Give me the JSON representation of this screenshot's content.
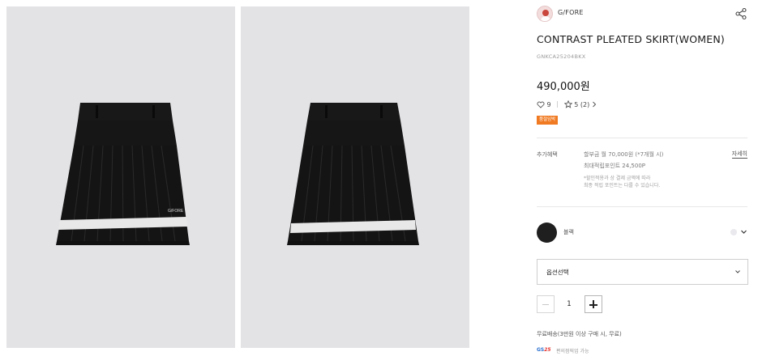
{
  "gallery": {
    "images": [
      {
        "alt": "",
        "logo_text": "G/FORE"
      },
      {
        "alt": ""
      }
    ]
  },
  "product": {
    "brand": "G/FORE",
    "title": "CONTRAST PLEATED SKIRT(WOMEN)",
    "code": "GNKCA25204BKX",
    "price": "490,000원",
    "likes": "9",
    "rating": "5",
    "reviews": "(2)",
    "badge": "품절임박"
  },
  "benefits": {
    "label": "추가혜택",
    "line1": "할부금 월 70,000원 (*7개월 시)",
    "line2": "최대적립포인트 24,500P",
    "note1": "*할인적용과 상 결제 금액에 따라",
    "note2": "최종 적립 포인트는 다를 수 있습니다.",
    "more_label": "자세히"
  },
  "color": {
    "name": "블랙",
    "swatch_color": "#1f1f1f"
  },
  "option": {
    "placeholder": "옵션선택"
  },
  "quantity": {
    "value": "1"
  },
  "shipping": {
    "text": "무료배송(3만원 이상 구매 시, 무료)",
    "gs_logo_a": "GS",
    "gs_logo_b": "25",
    "gs_text": "편의점픽업 가능"
  },
  "colors": {
    "accent_badge": "#f07a22",
    "photo_bg": "#e3e3e6",
    "skirt": "#141414",
    "stripe": "#e8e8e8"
  },
  "icons": {
    "share": "share-icon",
    "heart": "heart-icon",
    "star": "star-icon",
    "chevron": "chevron-down-icon",
    "minus": "minus-icon",
    "plus": "plus-icon"
  }
}
